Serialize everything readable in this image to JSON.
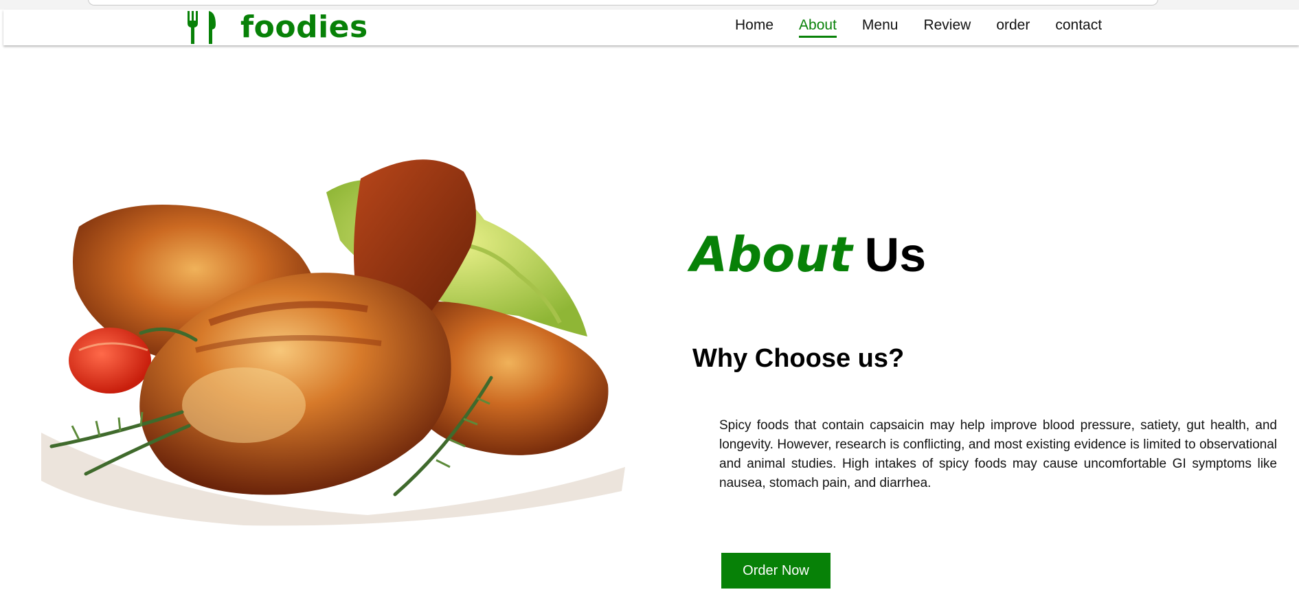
{
  "brand": {
    "name": "foodies",
    "icon": "fork-spoon-icon",
    "color": "#078107"
  },
  "nav": {
    "items": [
      {
        "label": "Home",
        "active": false
      },
      {
        "label": "About",
        "active": true
      },
      {
        "label": "Menu",
        "active": false
      },
      {
        "label": "Review",
        "active": false
      },
      {
        "label": "order",
        "active": false
      },
      {
        "label": "contact",
        "active": false
      }
    ]
  },
  "about": {
    "title_highlight": "About",
    "title_rest": "Us",
    "subtitle": "Why Choose us?",
    "body": "Spicy foods that contain capsaicin may help improve blood pressure, satiety, gut health, and longevity. However, research is conflicting, and most existing evidence is limited to observational and animal studies. High intakes of spicy foods may cause uncomfortable GI symptoms like nausea, stomach pain, and diarrhea.",
    "cta_label": "Order Now"
  },
  "hero_image": {
    "subject": "roasted-chicken-drumsticks-image"
  }
}
